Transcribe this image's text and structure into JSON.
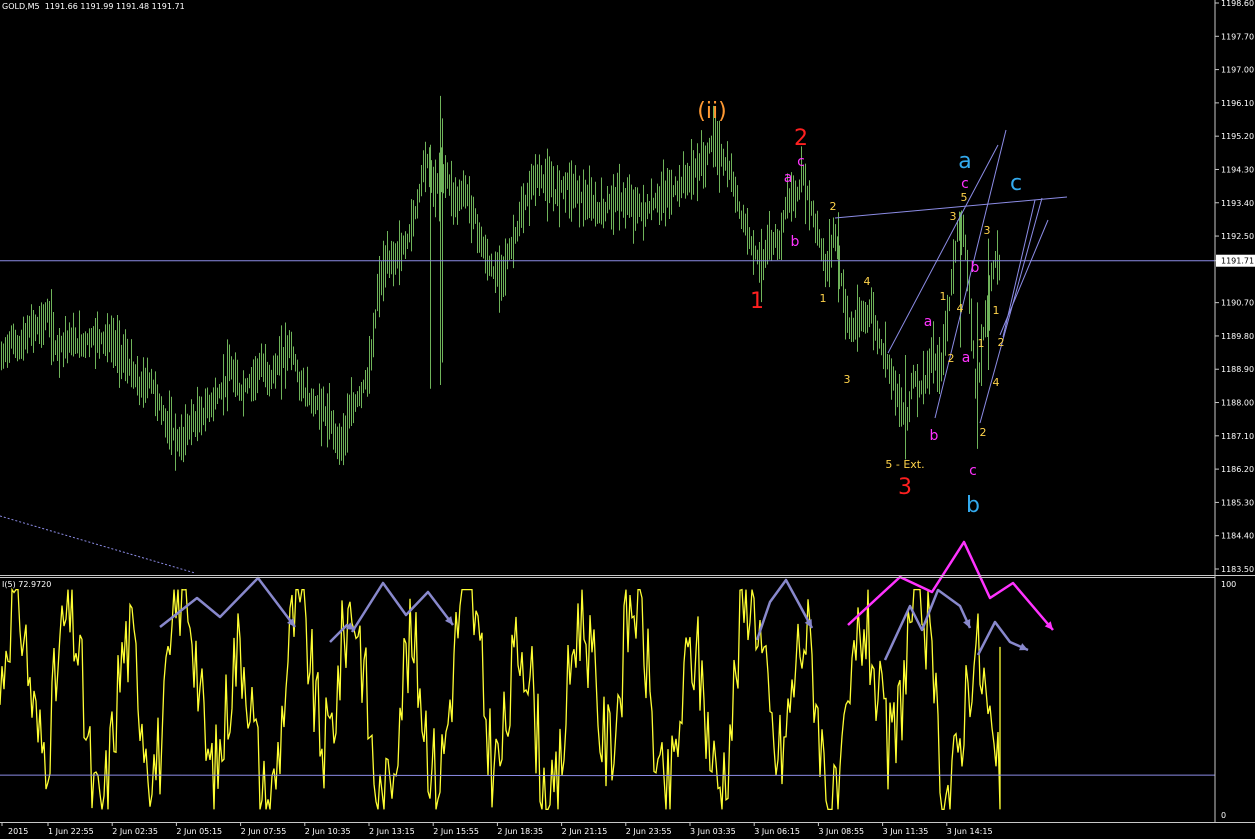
{
  "header": {
    "symbol_timeframe": "GOLD,M5",
    "ohlc": "1191.66 1191.99 1191.48 1191.71"
  },
  "indicator": {
    "label": "I(5) 72.9720",
    "scale_top": "100",
    "scale_bottom": "0"
  },
  "colors": {
    "background": "#000000",
    "candles": "#6fb35a",
    "indicator_line": "#ffff33",
    "trend_lines": "#8c8ce6",
    "wave_primary": "#ff2020",
    "wave_minor": "#ff33ff",
    "wave_yellow": "#ffd34a",
    "wave_blue": "#33aaee",
    "wave_orange": "#ff9933",
    "current_price_line": "#8c8ce6",
    "arrows_gray": "#8888cc",
    "arrows_magenta": "#ff33ff"
  },
  "price_axis": {
    "ticks": [
      "1198.60",
      "1197.70",
      "1197.00",
      "1196.10",
      "1195.20",
      "1194.30",
      "1193.40",
      "1192.50",
      "1191.71",
      "1190.70",
      "1189.80",
      "1188.90",
      "1188.00",
      "1187.10",
      "1186.20",
      "1185.30",
      "1184.40",
      "1183.50"
    ],
    "current_price": "1191.71"
  },
  "time_axis": {
    "ticks": [
      "2015",
      "1 Jun 22:55",
      "2 Jun 02:35",
      "2 Jun 05:15",
      "2 Jun 07:55",
      "2 Jun 10:35",
      "2 Jun 13:15",
      "2 Jun 15:55",
      "2 Jun 18:35",
      "2 Jun 21:15",
      "2 Jun 23:55",
      "3 Jun 03:35",
      "3 Jun 06:15",
      "3 Jun 08:55",
      "3 Jun 11:35",
      "3 Jun 14:15"
    ]
  },
  "chart_data": {
    "type": "candlestick",
    "symbol": "GOLD",
    "timeframe": "M5",
    "ylim": [
      1183.5,
      1198.6
    ],
    "close_profile": [
      [
        0,
        1189.0
      ],
      [
        10,
        1189.6
      ],
      [
        20,
        1189.4
      ],
      [
        30,
        1189.9
      ],
      [
        40,
        1190.0
      ],
      [
        48,
        1190.3
      ],
      [
        55,
        1189.4
      ],
      [
        65,
        1189.6
      ],
      [
        80,
        1189.5
      ],
      [
        95,
        1189.7
      ],
      [
        110,
        1189.6
      ],
      [
        125,
        1189.1
      ],
      [
        140,
        1188.3
      ],
      [
        150,
        1188.6
      ],
      [
        160,
        1187.8
      ],
      [
        170,
        1187.2
      ],
      [
        180,
        1186.8
      ],
      [
        190,
        1187.4
      ],
      [
        200,
        1187.5
      ],
      [
        210,
        1187.9
      ],
      [
        220,
        1188.2
      ],
      [
        230,
        1188.8
      ],
      [
        240,
        1188.2
      ],
      [
        250,
        1188.5
      ],
      [
        260,
        1188.9
      ],
      [
        270,
        1188.6
      ],
      [
        280,
        1189.0
      ],
      [
        290,
        1189.5
      ],
      [
        300,
        1188.4
      ],
      [
        310,
        1188.0
      ],
      [
        320,
        1187.8
      ],
      [
        330,
        1187.4
      ],
      [
        340,
        1186.8
      ],
      [
        350,
        1187.6
      ],
      [
        360,
        1188.2
      ],
      [
        370,
        1188.8
      ],
      [
        378,
        1191.0
      ],
      [
        386,
        1191.6
      ],
      [
        395,
        1191.8
      ],
      [
        405,
        1192.1
      ],
      [
        415,
        1193.0
      ],
      [
        425,
        1194.5
      ],
      [
        435,
        1193.6
      ],
      [
        445,
        1194.1
      ],
      [
        455,
        1193.3
      ],
      [
        465,
        1193.6
      ],
      [
        475,
        1192.8
      ],
      [
        485,
        1191.8
      ],
      [
        495,
        1191.3
      ],
      [
        505,
        1191.6
      ],
      [
        515,
        1192.4
      ],
      [
        525,
        1193.2
      ],
      [
        535,
        1194.0
      ],
      [
        545,
        1193.8
      ],
      [
        555,
        1193.5
      ],
      [
        565,
        1193.8
      ],
      [
        575,
        1193.6
      ],
      [
        585,
        1193.3
      ],
      [
        600,
        1193.0
      ],
      [
        615,
        1193.4
      ],
      [
        630,
        1193.2
      ],
      [
        645,
        1193.0
      ],
      [
        660,
        1193.4
      ],
      [
        675,
        1193.6
      ],
      [
        690,
        1194.0
      ],
      [
        705,
        1194.4
      ],
      [
        713,
        1195.0
      ],
      [
        720,
        1194.5
      ],
      [
        730,
        1194.0
      ],
      [
        740,
        1193.0
      ],
      [
        750,
        1192.3
      ],
      [
        760,
        1191.6
      ],
      [
        770,
        1192.1
      ],
      [
        780,
        1192.3
      ],
      [
        788,
        1193.5
      ],
      [
        796,
        1193.3
      ],
      [
        802,
        1194.0
      ],
      [
        810,
        1193.2
      ],
      [
        818,
        1192.4
      ],
      [
        826,
        1191.4
      ],
      [
        834,
        1192.6
      ],
      [
        842,
        1191.0
      ],
      [
        850,
        1189.8
      ],
      [
        860,
        1190.1
      ],
      [
        870,
        1190.4
      ],
      [
        880,
        1189.5
      ],
      [
        890,
        1188.9
      ],
      [
        900,
        1187.8
      ],
      [
        906,
        1187.3
      ],
      [
        912,
        1188.6
      ],
      [
        922,
        1188.3
      ],
      [
        932,
        1189.1
      ],
      [
        940,
        1188.7
      ],
      [
        950,
        1190.8
      ],
      [
        958,
        1192.8
      ],
      [
        964,
        1192.3
      ],
      [
        970,
        1190.7
      ],
      [
        976,
        1187.8
      ],
      [
        982,
        1189.6
      ],
      [
        988,
        1190.5
      ],
      [
        994,
        1191.8
      ],
      [
        1000,
        1191.6
      ]
    ],
    "indicator": {
      "name": "I(5)",
      "last_value": 72.972,
      "ylim": [
        0,
        100
      ],
      "level_line": 17
    },
    "wave_labels": [
      {
        "text": "(ii)",
        "color": "orange",
        "size": "large"
      },
      {
        "text": "2",
        "color": "red",
        "size": "large"
      },
      {
        "text": "1",
        "color": "red",
        "size": "large"
      },
      {
        "text": "3",
        "color": "red",
        "size": "large"
      },
      {
        "text": "a",
        "color": "blue",
        "size": "large"
      },
      {
        "text": "b",
        "color": "blue",
        "size": "large"
      },
      {
        "text": "c",
        "color": "blue",
        "size": "large"
      },
      {
        "text": "a",
        "color": "magenta",
        "size": "medium"
      },
      {
        "text": "c",
        "color": "magenta",
        "size": "medium"
      },
      {
        "text": "b",
        "color": "magenta",
        "size": "medium"
      },
      {
        "text": "a",
        "color": "magenta",
        "size": "medium"
      },
      {
        "text": "b",
        "color": "magenta",
        "size": "medium"
      },
      {
        "text": "c",
        "color": "magenta",
        "size": "medium"
      },
      {
        "text": "b",
        "color": "magenta",
        "size": "medium"
      },
      {
        "text": "a",
        "color": "magenta",
        "size": "medium"
      },
      {
        "text": "c",
        "color": "magenta",
        "size": "medium"
      },
      {
        "text": "2",
        "color": "yellow",
        "size": "small"
      },
      {
        "text": "1",
        "color": "yellow",
        "size": "small"
      },
      {
        "text": "4",
        "color": "yellow",
        "size": "small"
      },
      {
        "text": "3",
        "color": "yellow",
        "size": "small"
      },
      {
        "text": "5 - Ext.",
        "color": "yellow",
        "size": "small"
      },
      {
        "text": "5",
        "color": "yellow",
        "size": "small"
      },
      {
        "text": "3",
        "color": "yellow",
        "size": "small"
      },
      {
        "text": "1",
        "color": "yellow",
        "size": "small"
      },
      {
        "text": "4",
        "color": "yellow",
        "size": "small"
      },
      {
        "text": "2",
        "color": "yellow",
        "size": "small"
      },
      {
        "text": "3",
        "color": "yellow",
        "size": "small"
      },
      {
        "text": "1",
        "color": "yellow",
        "size": "small"
      },
      {
        "text": "1",
        "color": "yellow",
        "size": "small"
      },
      {
        "text": "2",
        "color": "yellow",
        "size": "small"
      },
      {
        "text": "4",
        "color": "yellow",
        "size": "small"
      },
      {
        "text": "2",
        "color": "yellow",
        "size": "small"
      }
    ]
  }
}
